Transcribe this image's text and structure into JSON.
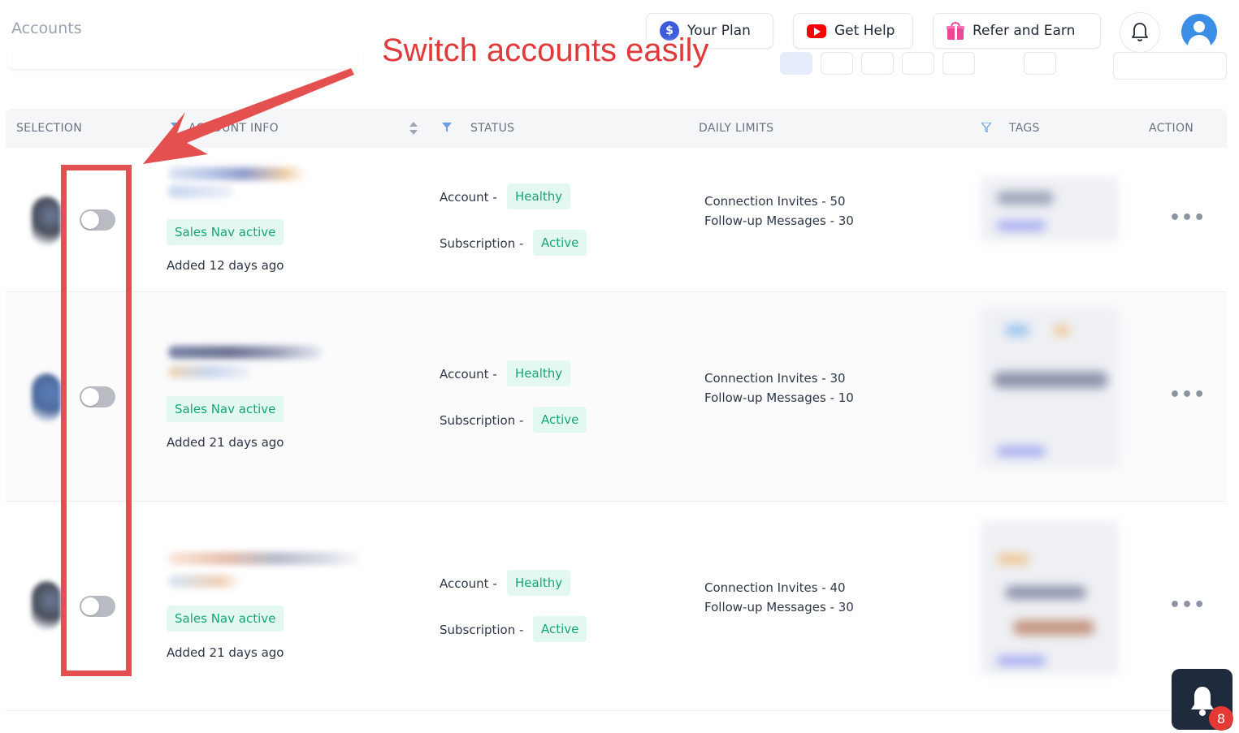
{
  "page": {
    "title": "Accounts"
  },
  "header": {
    "plan_label": "Your Plan",
    "help_label": "Get Help",
    "refer_label": "Refer and Earn"
  },
  "annotation": {
    "text": "Switch accounts easily"
  },
  "table": {
    "columns": {
      "selection": "SELECTION",
      "account_info": "ACCOUNT INFO",
      "status": "STATUS",
      "daily_limits": "DAILY LIMITS",
      "tags": "TAGS",
      "action": "ACTION"
    },
    "rows": [
      {
        "sales_nav": "Sales Nav active",
        "added": "Added 12 days ago",
        "account_label": "Account -",
        "account_status": "Healthy",
        "subscription_label": "Subscription -",
        "subscription_status": "Active",
        "connection_invites": "Connection Invites - 50",
        "followup_messages": "Follow-up Messages - 30",
        "action": "•••"
      },
      {
        "sales_nav": "Sales Nav active",
        "added": "Added 21 days ago",
        "account_label": "Account -",
        "account_status": "Healthy",
        "subscription_label": "Subscription -",
        "subscription_status": "Active",
        "connection_invites": "Connection Invites - 30",
        "followup_messages": "Follow-up Messages - 10",
        "action": "•••"
      },
      {
        "sales_nav": "Sales Nav active",
        "added": "Added 21 days ago",
        "account_label": "Account -",
        "account_status": "Healthy",
        "subscription_label": "Subscription -",
        "subscription_status": "Active",
        "connection_invites": "Connection Invites - 40",
        "followup_messages": "Follow-up Messages - 30",
        "action": "•••"
      }
    ]
  },
  "notifications": {
    "count": "8"
  },
  "colors": {
    "accent_green": "#17a673",
    "badge_bg": "#e3f8f0",
    "annotation_red": "#e45050",
    "plan_blue": "#3b5bdb",
    "youtube_red": "#ff0000",
    "gift_pink": "#ec4899"
  }
}
